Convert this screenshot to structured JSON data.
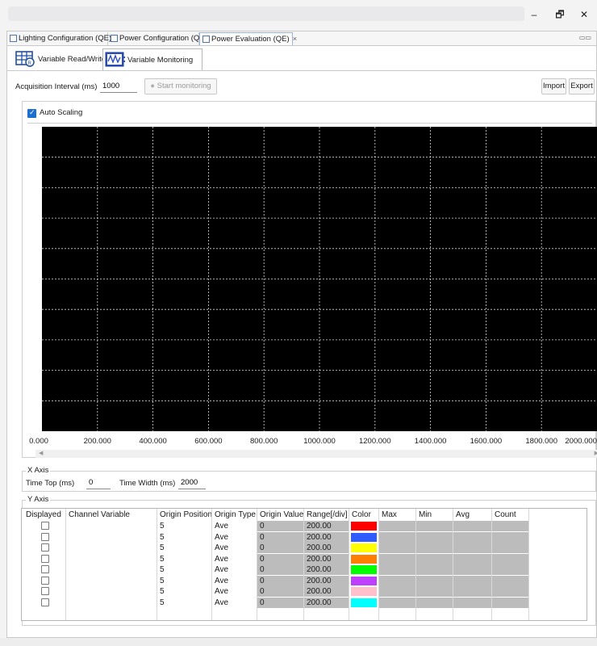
{
  "window": {
    "minimize_label": "–",
    "restore_label": "🗗",
    "close_label": "✕"
  },
  "editor_tabs": [
    {
      "label": "Lighting Configuration (QE)",
      "active": false
    },
    {
      "label": "Power Configuration (QE)",
      "active": false
    },
    {
      "label": "Power Evaluation (QE)",
      "active": true,
      "close_label": "×"
    }
  ],
  "subtabs": [
    {
      "label": "Variable Read/Write",
      "icon": "grid-chip-icon",
      "active": false
    },
    {
      "label": "Variable Monitoring",
      "icon": "waveform-monitor-icon",
      "active": true
    }
  ],
  "toolbar": {
    "interval_label": "Acquisition Interval (ms)",
    "interval_value": "1000",
    "start_label": "Start monitoring",
    "import_label": "Import",
    "export_label": "Export"
  },
  "chart": {
    "auto_scaling_label": "Auto Scaling",
    "auto_scaling_checked": true,
    "background": "#000000",
    "grid_color": "#d9d9d9"
  },
  "chart_data": {
    "type": "line",
    "title": "",
    "xlabel": "",
    "ylabel": "",
    "x_ticks": [
      "0.000",
      "200.000",
      "400.000",
      "600.000",
      "800.000",
      "1000.000",
      "1200.000",
      "1400.000",
      "1600.000",
      "1800.000",
      "2000.000"
    ],
    "xlim": [
      0,
      2000
    ],
    "y_divisions": 10,
    "grid": true,
    "series": []
  },
  "x_axis": {
    "legend": "X Axis",
    "time_top_label": "Time Top (ms)",
    "time_top_value": "0",
    "time_width_label": "Time Width (ms)",
    "time_width_value": "2000"
  },
  "y_axis": {
    "legend": "Y Axis",
    "columns": [
      "Displayed",
      "Channel Variable",
      "Origin Position",
      "Origin Type",
      "Origin Value",
      "Range[/div]",
      "Color",
      "Max",
      "Min",
      "Avg",
      "Count"
    ],
    "rows": [
      {
        "displayed": false,
        "channel": "",
        "origin_position": "5",
        "origin_type": "Ave",
        "origin_value": "0",
        "range": "200.00",
        "color": "#ff0000"
      },
      {
        "displayed": false,
        "channel": "",
        "origin_position": "5",
        "origin_type": "Ave",
        "origin_value": "0",
        "range": "200.00",
        "color": "#2f5cff"
      },
      {
        "displayed": false,
        "channel": "",
        "origin_position": "5",
        "origin_type": "Ave",
        "origin_value": "0",
        "range": "200.00",
        "color": "#ffff00"
      },
      {
        "displayed": false,
        "channel": "",
        "origin_position": "5",
        "origin_type": "Ave",
        "origin_value": "0",
        "range": "200.00",
        "color": "#ff7f00"
      },
      {
        "displayed": false,
        "channel": "",
        "origin_position": "5",
        "origin_type": "Ave",
        "origin_value": "0",
        "range": "200.00",
        "color": "#00ff00"
      },
      {
        "displayed": false,
        "channel": "",
        "origin_position": "5",
        "origin_type": "Ave",
        "origin_value": "0",
        "range": "200.00",
        "color": "#bf3fff"
      },
      {
        "displayed": false,
        "channel": "",
        "origin_position": "5",
        "origin_type": "Ave",
        "origin_value": "0",
        "range": "200.00",
        "color": "#ffc0cb"
      },
      {
        "displayed": false,
        "channel": "",
        "origin_position": "5",
        "origin_type": "Ave",
        "origin_value": "0",
        "range": "200.00",
        "color": "#00ffff"
      }
    ]
  }
}
